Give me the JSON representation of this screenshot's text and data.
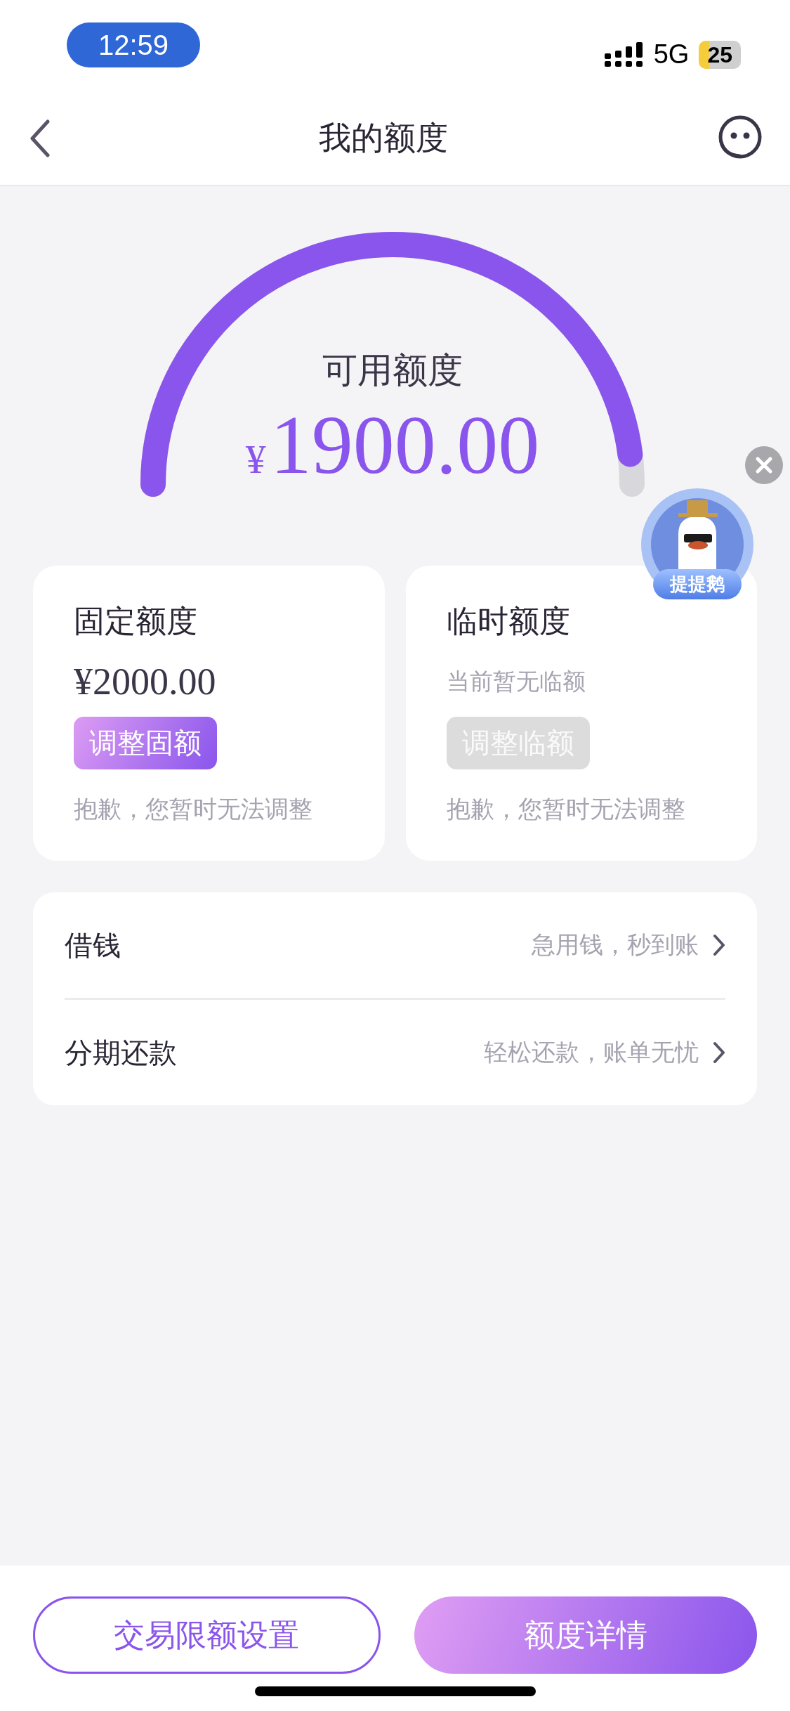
{
  "status_bar": {
    "time": "12:59",
    "network": "5G",
    "battery": "25"
  },
  "header": {
    "title": "我的额度"
  },
  "gauge": {
    "label": "可用额度",
    "currency": "¥",
    "amount": "1900.00"
  },
  "floating_widget": {
    "label": "提提鹅"
  },
  "cards": [
    {
      "title": "固定额度",
      "subtitle": "¥2000.00",
      "kind": "amount",
      "button": "调整固额",
      "disabled": false,
      "note": "抱歉，您暂时无法调整"
    },
    {
      "title": "临时额度",
      "subtitle": "当前暂无临额",
      "kind": "hint",
      "button": "调整临额",
      "disabled": true,
      "note": "抱歉，您暂时无法调整"
    }
  ],
  "menu": [
    {
      "label": "借钱",
      "hint": "急用钱，秒到账"
    },
    {
      "label": "分期还款",
      "hint": "轻松还款，账单无忧"
    }
  ],
  "buttons": [
    {
      "label": "交易限额设置",
      "kind": "outline"
    },
    {
      "label": "额度详情",
      "kind": "filled"
    }
  ]
}
